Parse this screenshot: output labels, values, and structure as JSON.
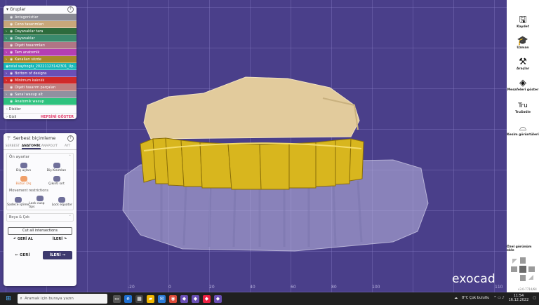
{
  "groups": {
    "title": "Gruplar",
    "rows": [
      {
        "label": "Antagonistler",
        "color": "#8c8c95",
        "expand": false
      },
      {
        "label": "Ceno tasarımları",
        "color": "#c8a77a",
        "expand": false
      },
      {
        "label": "Dayanaklar tara",
        "color": "#2d6b3c",
        "expand": true
      },
      {
        "label": "Dayanaklar",
        "color": "#3a8a6c",
        "expand": true
      },
      {
        "label": "Dişeti tasarımları",
        "color": "#b07585",
        "expand": false
      },
      {
        "label": "Tam anatomik",
        "color": "#b43fb2",
        "expand": true
      },
      {
        "label": "Kanalları sözde",
        "color": "#a88a2a",
        "expand": true
      },
      {
        "label": "celal sayhoglu_20221123142301_Up...",
        "color": "#18b8b8",
        "expand": false
      },
      {
        "label": "Bottom of designs",
        "color": "#6a4fb5",
        "expand": true
      },
      {
        "label": "Minimum kalınlık",
        "color": "#d02a2a",
        "expand": true
      },
      {
        "label": "Dişeti tasarım parçaları",
        "color": "#c08080",
        "expand": false
      },
      {
        "label": "Sanal waxup alt",
        "color": "#9090a0",
        "expand": true
      },
      {
        "label": "Anatomik waxup",
        "color": "#2ec27e",
        "expand": false
      }
    ],
    "foot1": "Diskler",
    "foot2": "Gizli",
    "show_all": "HEPSİNİ GÖSTER"
  },
  "sculpt": {
    "title": "Serbest biçimleme",
    "tabs": [
      "SERBEST",
      "ANATOMİK",
      "ANAPOLYT",
      "AYT"
    ],
    "active_tab": 1,
    "presets_title": "Ön ayarlar",
    "tools": [
      {
        "label": "Diş uçları"
      },
      {
        "label": "Diş Kısımları"
      },
      {
        "label": "Bütün Diş",
        "selected": true
      },
      {
        "label": "Çıkıntı sırt"
      }
    ],
    "movement_title": "Movement restrictions",
    "movement": [
      {
        "label": "Sadece işlime"
      },
      {
        "label": "Lock cusp tips"
      },
      {
        "label": "Lock equator"
      }
    ],
    "paint_label": "Boya & Çek",
    "cut_all": "Cut all intersections",
    "undo": "GERİ AL",
    "redo": "İLERİ",
    "back": "GERİ",
    "next": "İLERİ"
  },
  "rightbar": {
    "items": [
      {
        "label": "Kaydet",
        "icon": "save-icon"
      },
      {
        "label": "Uzman",
        "icon": "graduation-cap-icon"
      },
      {
        "label": "Araçlar",
        "icon": "tools-icon"
      },
      {
        "label": "Mesafeleri göster",
        "icon": "distance-icon"
      },
      {
        "label": "TruSmile",
        "icon": "trusmile-icon"
      },
      {
        "label": "Kesim görüntüleri",
        "icon": "cut-view-icon"
      }
    ],
    "view_label": "Özel görünüm ekle",
    "version": "v3.0-7714/64"
  },
  "brand": "exocad",
  "ruler": [
    "-20",
    "0",
    "20",
    "40",
    "60",
    "80",
    "100",
    "110"
  ],
  "taskbar": {
    "search_placeholder": "Aramak için buraya yazın",
    "weather": "8°C Çok bulutlu",
    "time": "11:54",
    "date": "16.12.2022"
  }
}
